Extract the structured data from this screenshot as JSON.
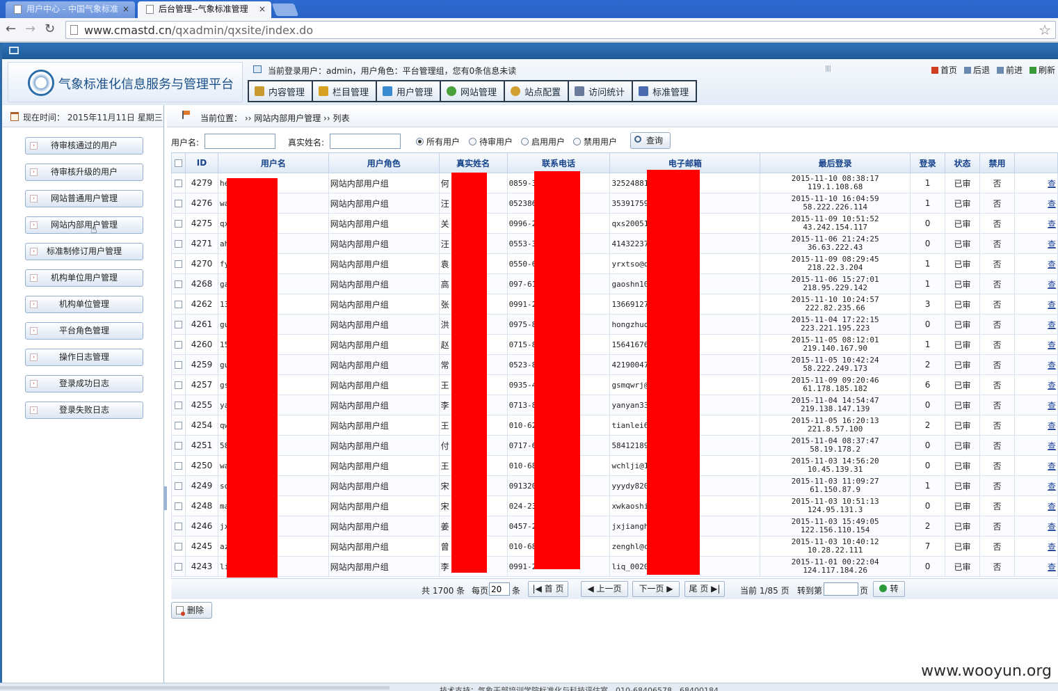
{
  "browser": {
    "tabs": [
      {
        "title": "用户中心 - 中国气象标准",
        "close": "×",
        "active": false
      },
      {
        "title": "后台管理--气象标准管理",
        "close": "×",
        "active": true
      }
    ],
    "url_host": "www.cmastd.cn",
    "url_path": "/qxadmin/qxsite/index.do",
    "back_glyph": "←",
    "forward_glyph": "→",
    "reload_glyph": "↻",
    "star_glyph": "☆"
  },
  "header": {
    "site_title": "气象标准化信息服务与管理平台",
    "user_info": "当前登录用户：admin，用户角色：平台管理组，您有0条信息未读",
    "grip": "||||",
    "quick_links": [
      {
        "label": "首页",
        "icon": "home-icon",
        "color": "#d04020"
      },
      {
        "label": "后退",
        "icon": "back-icon",
        "color": "#6a8ab0"
      },
      {
        "label": "前进",
        "icon": "forward-icon",
        "color": "#6a8ab0"
      },
      {
        "label": "刷新",
        "icon": "refresh-icon",
        "color": "#3a9a3a"
      }
    ],
    "menu": [
      {
        "label": "内容管理",
        "icon": "edit-icon",
        "color": "#c89a30"
      },
      {
        "label": "栏目管理",
        "icon": "folder-icon",
        "color": "#d8a020"
      },
      {
        "label": "用户管理",
        "icon": "users-icon",
        "color": "#3a8ad0"
      },
      {
        "label": "网站管理",
        "icon": "globe-icon",
        "color": "#4aa03a"
      },
      {
        "label": "站点配置",
        "icon": "gear-icon",
        "color": "#d0a030"
      },
      {
        "label": "访问统计",
        "icon": "chart-icon",
        "color": "#6a7a9a"
      },
      {
        "label": "标准管理",
        "icon": "document-icon",
        "color": "#4a6ab0"
      }
    ]
  },
  "sidebar": {
    "time_text": "现在时间：  2015年11月11日  星期三",
    "items": [
      {
        "label": "待审核通过的用户"
      },
      {
        "label": "待审核升级的用户"
      },
      {
        "label": "网站普通用户管理"
      },
      {
        "label": "网站内部用户管理"
      },
      {
        "label": "标准制修订用户管理"
      },
      {
        "label": "机构单位用户管理"
      },
      {
        "label": "机构单位管理"
      },
      {
        "label": "平台角色管理"
      },
      {
        "label": "操作日志管理"
      },
      {
        "label": "登录成功日志"
      },
      {
        "label": "登录失败日志"
      }
    ],
    "arrow_glyph": "›"
  },
  "breadcrumb": {
    "text": "当前位置： ›› 网站内部用户管理 ›› 列表"
  },
  "search": {
    "username_label": "用户名:",
    "realname_label": "真实姓名:",
    "username_value": "",
    "realname_value": "",
    "radios": [
      {
        "label": "所有用户",
        "checked": true
      },
      {
        "label": "待审用户",
        "checked": false
      },
      {
        "label": "启用用户",
        "checked": false
      },
      {
        "label": "禁用用户",
        "checked": false
      }
    ],
    "query_label": "查询"
  },
  "table": {
    "columns": [
      "",
      "ID",
      "用户名",
      "用户角色",
      "真实姓名",
      "联系电话",
      "电子邮箱",
      "最后登录",
      "登录",
      "状态",
      "禁用",
      ""
    ],
    "rows": [
      {
        "id": "4279",
        "username": "he",
        "role": "网站内部用户组",
        "realname": "何",
        "phone": "0859-32",
        "email": "325248810",
        "last_login_time": "2015-11-10 08:38:17",
        "last_login_ip": "119.1.108.68",
        "logins": "1",
        "status": "已审",
        "disabled": "否",
        "action": "查"
      },
      {
        "id": "4276",
        "username": "wa",
        "role": "网站内部用户组",
        "realname": "汪",
        "phone": "0523868",
        "email": "353917590",
        "last_login_time": "2015-11-10 16:04:59",
        "last_login_ip": "58.222.226.114",
        "logins": "1",
        "status": "已审",
        "disabled": "否",
        "action": "查"
      },
      {
        "id": "4275",
        "username": "qx",
        "role": "网站内部用户组",
        "realname": "关",
        "phone": "0996-27",
        "email": "qxs200516",
        "last_login_time": "2015-11-09 10:51:52",
        "last_login_ip": "43.242.154.117",
        "logins": "0",
        "status": "已审",
        "disabled": "否",
        "action": "查"
      },
      {
        "id": "4271",
        "username": "ah",
        "role": "网站内部用户组",
        "realname": "汪",
        "phone": "0553-39",
        "email": "414322374",
        "last_login_time": "2015-11-06 21:24:25",
        "last_login_ip": "36.63.222.43",
        "logins": "0",
        "status": "已审",
        "disabled": "否",
        "action": "查"
      },
      {
        "id": "4270",
        "username": "fy",
        "role": "网站内部用户组",
        "realname": "袁",
        "phone": "0550-67",
        "email": "yrxtso@qq",
        "last_login_time": "2015-11-09 08:29:45",
        "last_login_ip": "218.22.3.204",
        "logins": "1",
        "status": "已审",
        "disabled": "否",
        "action": "查"
      },
      {
        "id": "4268",
        "username": "ga",
        "role": "网站内部用户组",
        "realname": "高",
        "phone": "097-613",
        "email": "gaoshn100",
        "last_login_time": "2015-11-06 15:27:01",
        "last_login_ip": "218.95.229.142",
        "logins": "1",
        "status": "已审",
        "disabled": "否",
        "action": "查"
      },
      {
        "id": "4262",
        "username": "13",
        "role": "网站内部用户组",
        "realname": "张",
        "phone": "0991-26",
        "email": "136691272",
        "last_login_time": "2015-11-10 10:24:57",
        "last_login_ip": "222.82.235.66",
        "logins": "3",
        "status": "已审",
        "disabled": "否",
        "action": "查"
      },
      {
        "id": "4261",
        "username": "gu",
        "role": "网站内部用户组",
        "realname": "洪",
        "phone": "0975-83",
        "email": "hongzhuol",
        "last_login_time": "2015-11-04 17:22:15",
        "last_login_ip": "223.221.195.223",
        "logins": "0",
        "status": "已审",
        "disabled": "否",
        "action": "查"
      },
      {
        "id": "4260",
        "username": "15",
        "role": "网站内部用户组",
        "realname": "赵",
        "phone": "0715-82",
        "email": "156416764",
        "last_login_time": "2015-11-05 08:12:01",
        "last_login_ip": "219.140.167.90",
        "logins": "1",
        "status": "已审",
        "disabled": "否",
        "action": "查"
      },
      {
        "id": "4259",
        "username": "gu",
        "role": "网站内部用户组",
        "realname": "常",
        "phone": "0523-86",
        "email": "421900471",
        "last_login_time": "2015-11-05 10:42:24",
        "last_login_ip": "58.222.249.173",
        "logins": "2",
        "status": "已审",
        "disabled": "否",
        "action": "查"
      },
      {
        "id": "4257",
        "username": "gs",
        "role": "网站内部用户组",
        "realname": "王",
        "phone": "0935-41",
        "email": "gsmqwrj@1",
        "last_login_time": "2015-11-09 09:20:46",
        "last_login_ip": "61.178.185.182",
        "logins": "6",
        "status": "已审",
        "disabled": "否",
        "action": "查"
      },
      {
        "id": "4255",
        "username": "ya",
        "role": "网站内部用户组",
        "realname": "李",
        "phone": "0713-88",
        "email": "yanyan330",
        "last_login_time": "2015-11-04 14:54:47",
        "last_login_ip": "219.138.147.139",
        "logins": "0",
        "status": "已审",
        "disabled": "否",
        "action": "查"
      },
      {
        "id": "4254",
        "username": "qw",
        "role": "网站内部用户组",
        "realname": "王",
        "phone": "010-620",
        "email": "tianlei62",
        "last_login_time": "2015-11-05 16:20:13",
        "last_login_ip": "221.8.57.100",
        "logins": "2",
        "status": "已审",
        "disabled": "否",
        "action": "查"
      },
      {
        "id": "4251",
        "username": "58",
        "role": "网站内部用户组",
        "realname": "付",
        "phone": "0717-63",
        "email": "584121897",
        "last_login_time": "2015-11-04 08:37:47",
        "last_login_ip": "58.19.178.2",
        "logins": "0",
        "status": "已审",
        "disabled": "否",
        "action": "查"
      },
      {
        "id": "4250",
        "username": "wa",
        "role": "网站内部用户组",
        "realname": "王",
        "phone": "010-684",
        "email": "wchlji@16",
        "last_login_time": "2015-11-03 14:56:20",
        "last_login_ip": "10.45.139.31",
        "logins": "0",
        "status": "已审",
        "disabled": "否",
        "action": "查"
      },
      {
        "id": "4249",
        "username": "so",
        "role": "网站内部用户组",
        "realname": "宋",
        "phone": "0913203",
        "email": "yyydy8200",
        "last_login_time": "2015-11-03 11:09:27",
        "last_login_ip": "61.150.87.9",
        "logins": "1",
        "status": "已审",
        "disabled": "否",
        "action": "查"
      },
      {
        "id": "4248",
        "username": "ma",
        "role": "网站内部用户组",
        "realname": "宋",
        "phone": "024-230",
        "email": "xwkaoshi@",
        "last_login_time": "2015-11-03 10:51:13",
        "last_login_ip": "124.95.131.3",
        "logins": "0",
        "status": "已审",
        "disabled": "否",
        "action": "查"
      },
      {
        "id": "4246",
        "username": "jx",
        "role": "网站内部用户组",
        "realname": "姜",
        "phone": "0457-23",
        "email": "jxjiangh_",
        "last_login_time": "2015-11-03 15:49:05",
        "last_login_ip": "122.156.110.154",
        "logins": "2",
        "status": "已审",
        "disabled": "否",
        "action": "查"
      },
      {
        "id": "4245",
        "username": "az",
        "role": "网站内部用户组",
        "realname": "曾",
        "phone": "010-684",
        "email": "zenghl@cm",
        "last_login_time": "2015-11-03 10:40:12",
        "last_login_ip": "10.28.22.111",
        "logins": "7",
        "status": "已审",
        "disabled": "否",
        "action": "查"
      },
      {
        "id": "4243",
        "username": "li",
        "role": "网站内部用户组",
        "realname": "李",
        "phone": "0991-26",
        "email": "liq_0020@",
        "last_login_time": "2015-11-01 00:22:04",
        "last_login_ip": "124.117.184.26",
        "logins": "0",
        "status": "已审",
        "disabled": "否",
        "action": "查"
      }
    ]
  },
  "pager": {
    "total": "共 1700 条",
    "per_page_label": "每页",
    "per_page_value": "20",
    "per_page_unit": "条",
    "first": "首 页",
    "prev": "上一页",
    "next": "下一页",
    "last": "尾 页",
    "current": "当前 1/85 页",
    "goto_label": "转到第",
    "goto_unit": "页",
    "goto_btn": "转",
    "goto_value": ""
  },
  "delete_label": "删除",
  "footer_text": "技术支持：气象干部培训学院标准化与科技评估室，010-68406578，68400184",
  "watermark": "www.wooyun.org",
  "colors": {
    "accent": "#2c6aa8",
    "header_text": "#15428b",
    "redaction": "#ff0000"
  }
}
